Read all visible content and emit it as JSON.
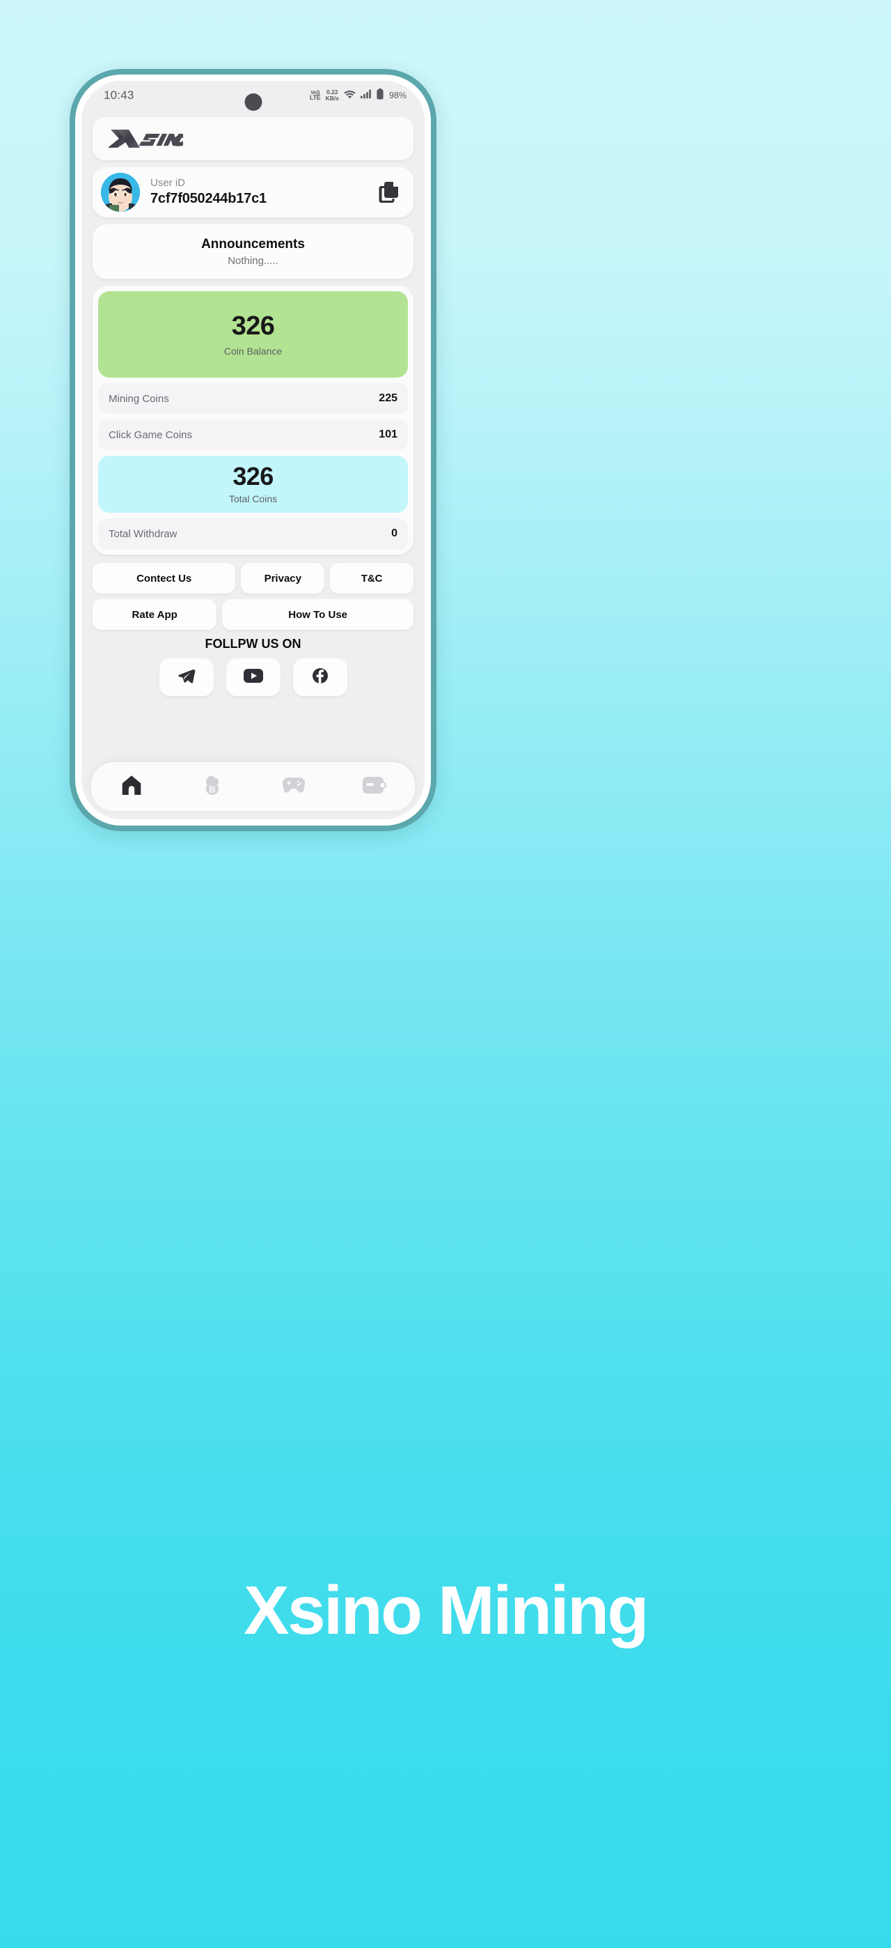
{
  "statusbar": {
    "time": "10:43",
    "volte_top": "Vo))",
    "volte_bottom": "LTE",
    "netspeed_value": "0.22",
    "netspeed_unit": "KB/s",
    "battery": "98%",
    "wifi_icon": "wifi-icon",
    "signal_icon": "signal-bars-icon",
    "battery_icon": "battery-icon",
    "camera_icon": "front-camera-punch-hole"
  },
  "header": {
    "brand_x": "X",
    "brand_word": "SINO",
    "logo_name": "xsino-logo"
  },
  "user": {
    "id_label": "User iD",
    "id_value": "7cf7f050244b17c1",
    "copy_icon": "copy-icon",
    "avatar_alt": "anime-avatar"
  },
  "announcements": {
    "title": "Announcements",
    "body": "Nothing....."
  },
  "stats": {
    "coin_balance": {
      "value": "326",
      "label": "Coin Balance",
      "color": "#b2e392"
    },
    "rows": [
      {
        "label": "Mining Coins",
        "value": "225"
      },
      {
        "label": "Click Game Coins",
        "value": "101"
      }
    ],
    "total_coins": {
      "value": "326",
      "label": "Total Coins",
      "color": "#c2f6fb"
    },
    "total_withdraw": {
      "label": "Total Withdraw",
      "value": "0"
    }
  },
  "links": {
    "row1": [
      {
        "label": "Contect Us"
      },
      {
        "label": "Privacy"
      },
      {
        "label": "T&C"
      }
    ],
    "row2": [
      {
        "label": "Rate App"
      },
      {
        "label": "How To Use"
      }
    ]
  },
  "follow": {
    "title": "FOLLPW US ON",
    "items": [
      {
        "icon": "telegram-icon"
      },
      {
        "icon": "youtube-icon"
      },
      {
        "icon": "facebook-icon"
      }
    ]
  },
  "bottom_nav": [
    {
      "icon": "home-icon",
      "active": true
    },
    {
      "icon": "bitcoin-cloud-mining-icon",
      "active": false
    },
    {
      "icon": "gamepad-icon",
      "active": false
    },
    {
      "icon": "wallet-icon",
      "active": false
    }
  ],
  "caption": {
    "text": "Xsino Mining"
  },
  "theme": {
    "frame_color": "#5ba7ac",
    "bg_top": "#cdf7fb",
    "bg_bottom": "#35dbec",
    "accent_green": "#b2e392",
    "accent_cyan": "#c2f6fb"
  }
}
